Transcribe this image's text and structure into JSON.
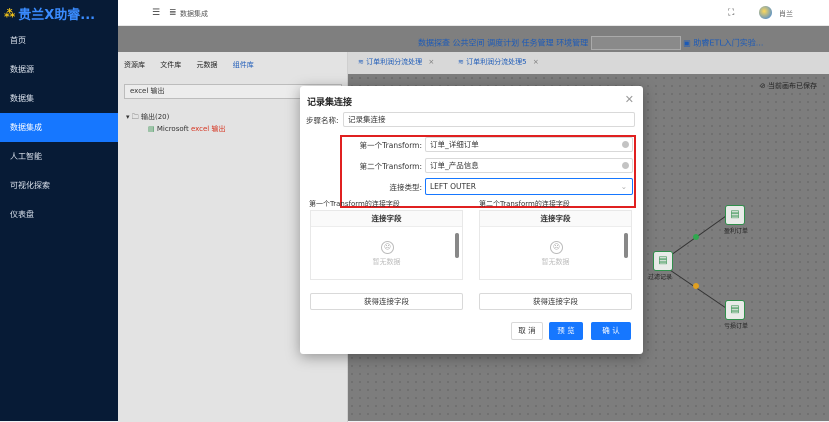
{
  "app": {
    "logo_mark": "⁂",
    "title": "贵兰X助睿..."
  },
  "sidebar": {
    "items": [
      {
        "label": "首页"
      },
      {
        "label": "数据源"
      },
      {
        "label": "数据集"
      },
      {
        "label": "数据集成",
        "active": true
      },
      {
        "label": "人工智能"
      },
      {
        "label": "可视化探索"
      },
      {
        "label": "仪表盘"
      }
    ]
  },
  "topbar": {
    "menu_icon": "☰",
    "breadcrumb_icon": "≣",
    "breadcrumb": "数据集成",
    "fullscreen_icon": "⛶",
    "username": "肖兰"
  },
  "menu": {
    "items": [
      "数据探查",
      "公共空间",
      "调度计划",
      "任务管理",
      "环境管理"
    ],
    "env_select_value": "",
    "help_link": "助睿ETL入门实验..."
  },
  "left_panel": {
    "tabs": [
      "资源库",
      "文件库",
      "元数据",
      "组件库"
    ],
    "active_tab": "组件库",
    "search_value": "excel 输出",
    "tree": {
      "folder_label": "输出(20)",
      "item_prefix": "Microsoft ",
      "item_highlight": "excel 输出"
    }
  },
  "editor": {
    "tabs": [
      {
        "label": "订单利润分流处理"
      },
      {
        "label": "订单利润分流处理5"
      }
    ],
    "save_status": "当前画布已保存",
    "nodes": [
      {
        "label": "过滤记录"
      },
      {
        "label": "盈利订单"
      },
      {
        "label": "亏损订单"
      }
    ]
  },
  "dialog": {
    "title": "记录集连接",
    "step_name_label": "步骤名称",
    "step_name_value": "记录集连接",
    "first_transform_label": "第一个Transform",
    "first_transform_value": "订单_详细订单",
    "second_transform_label": "第二个Transform",
    "second_transform_value": "订单_产品信息",
    "join_type_label": "连接类型",
    "join_type_value": "LEFT OUTER",
    "left_section_title": "第一个Transform的连接字段",
    "right_section_title": "第二个Transform的连接字段",
    "col_header": "连接字段",
    "empty_text": "暂无数据",
    "get_fields_label": "获得连接字段",
    "cancel_label": "取 消",
    "preview_label": "预 览",
    "confirm_label": "确 认"
  },
  "colors": {
    "sidebar_bg": "#071b36",
    "accent": "#1677ff",
    "highlight": "#e02020",
    "canvas_bg": "#7d7d7d"
  }
}
